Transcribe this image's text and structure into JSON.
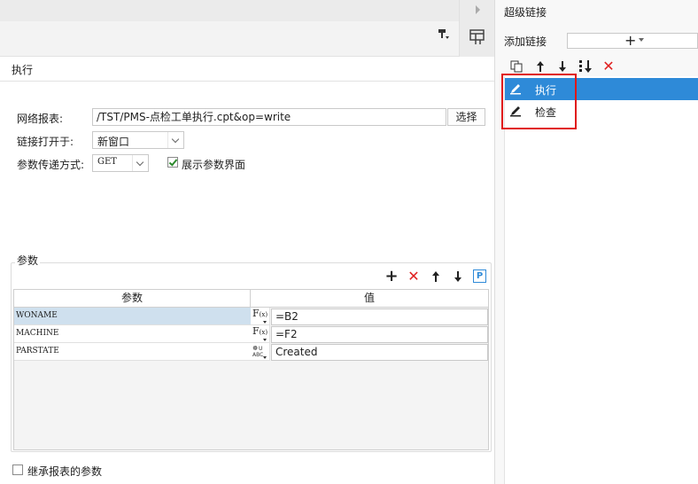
{
  "right_panel": {
    "title": "超级链接",
    "add_link_label": "添加链接",
    "link_items": [
      {
        "label": "执行",
        "selected": true
      },
      {
        "label": "检查",
        "selected": false
      }
    ]
  },
  "tab": {
    "title": "执行"
  },
  "form": {
    "report_label": "网络报表:",
    "report_value": "/TST/PMS-点检工单执行.cpt&op=write",
    "select_button": "选择",
    "open_in_label": "链接打开于:",
    "open_in_value": "新窗口",
    "param_method_label": "参数传递方式:",
    "param_method_value": "GET",
    "show_params_label": "展示参数界面",
    "show_params_checked": true
  },
  "params": {
    "group_title": "参数",
    "columns": [
      "参数",
      "值"
    ],
    "rows": [
      {
        "name": "WONAME",
        "type": "F(x)",
        "value": "=B2"
      },
      {
        "name": "MACHINE",
        "type": "F(x)",
        "value": "=F2"
      },
      {
        "name": "PARSTATE",
        "type": "text",
        "value": "Created"
      }
    ]
  },
  "inherit_params_label": "继承报表的参数",
  "colors": {
    "accent": "#2e8ad8",
    "delete": "#e02020",
    "highlight_box": "#e01818"
  }
}
